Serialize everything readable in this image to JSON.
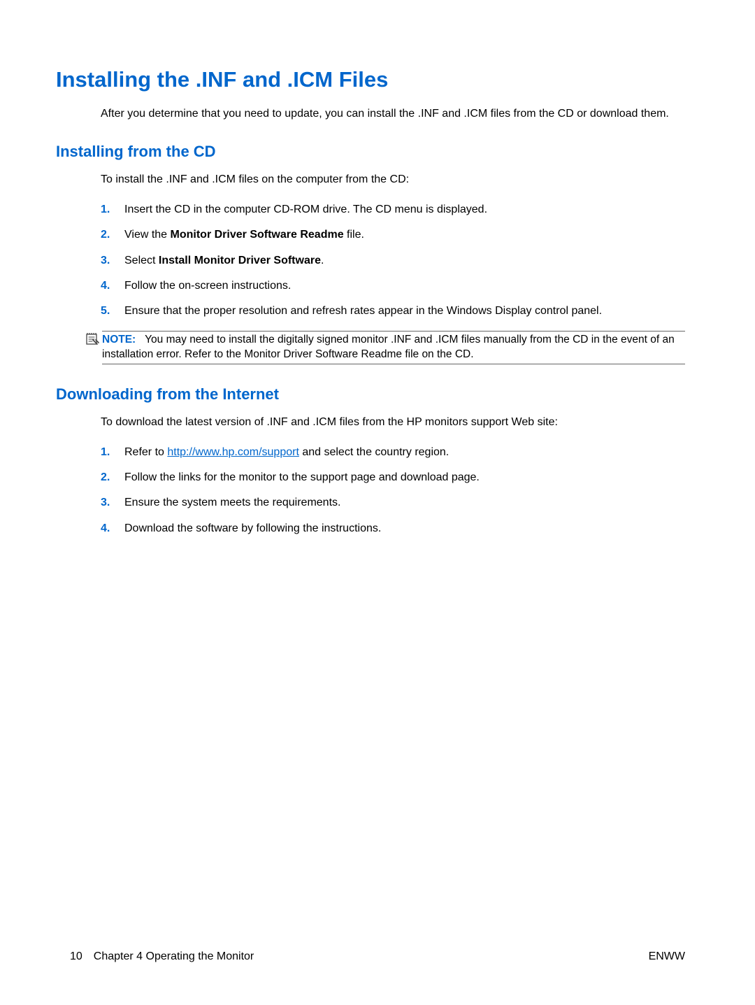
{
  "mainHeading": "Installing the .INF and .ICM Files",
  "introText": "After you determine that you need to update, you can install the .INF and .ICM files from the CD or download them.",
  "section1": {
    "heading": "Installing from the CD",
    "intro": "To install the .INF and .ICM files on the computer from the CD:",
    "steps": [
      {
        "num": "1.",
        "text": "Insert the CD in the computer CD-ROM drive. The CD menu is displayed."
      },
      {
        "num": "2.",
        "prefix": "View the ",
        "bold": "Monitor Driver Software Readme",
        "suffix": " file."
      },
      {
        "num": "3.",
        "prefix": "Select ",
        "bold": "Install Monitor Driver Software",
        "suffix": "."
      },
      {
        "num": "4.",
        "text": "Follow the on-screen instructions."
      },
      {
        "num": "5.",
        "text": "Ensure that the proper resolution and refresh rates appear in the Windows Display control panel."
      }
    ],
    "note": {
      "label": "NOTE:",
      "text": "You may need to install the digitally signed monitor .INF and .ICM files manually from the CD in the event of an installation error. Refer to the Monitor Driver Software Readme file on the CD."
    }
  },
  "section2": {
    "heading": "Downloading from the Internet",
    "intro": "To download the latest version of .INF and .ICM files from the HP monitors support Web site:",
    "steps": [
      {
        "num": "1.",
        "prefix": "Refer to ",
        "link": "http://www.hp.com/support",
        "suffix": " and select the country region."
      },
      {
        "num": "2.",
        "text": "Follow the links for the monitor to the support page and download page."
      },
      {
        "num": "3.",
        "text": "Ensure the system meets the requirements."
      },
      {
        "num": "4.",
        "text": "Download the software by following the instructions."
      }
    ]
  },
  "footer": {
    "pageNum": "10",
    "chapter": "Chapter 4   Operating the Monitor",
    "right": "ENWW"
  }
}
